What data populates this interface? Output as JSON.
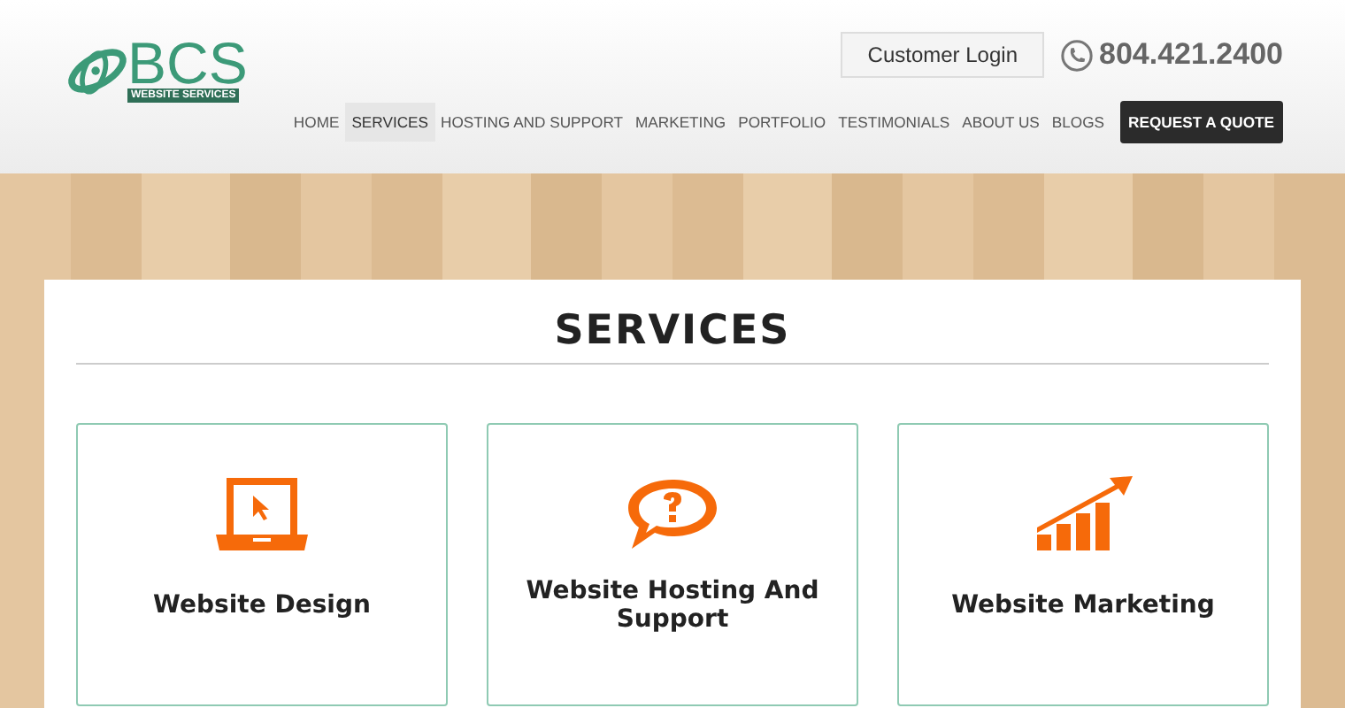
{
  "logo": {
    "name": "BCS",
    "tagline": "WEBSITE SERVICES"
  },
  "login_button": "Customer Login",
  "phone": "804.421.2400",
  "nav": [
    {
      "label": "HOME",
      "selected": false
    },
    {
      "label": "SERVICES",
      "selected": true
    },
    {
      "label": "HOSTING AND SUPPORT",
      "selected": false
    },
    {
      "label": "MARKETING",
      "selected": false
    },
    {
      "label": "PORTFOLIO",
      "selected": false
    },
    {
      "label": "TESTIMONIALS",
      "selected": false
    },
    {
      "label": "ABOUT US",
      "selected": false
    },
    {
      "label": "BLOGS",
      "selected": false
    }
  ],
  "quote_button": "REQUEST A QUOTE",
  "heading": "SERVICES",
  "services": [
    {
      "title": "Website Design",
      "kind": "laptop"
    },
    {
      "title": "Website Hosting And Support",
      "kind": "chat"
    },
    {
      "title": "Website Marketing",
      "kind": "chart"
    }
  ]
}
